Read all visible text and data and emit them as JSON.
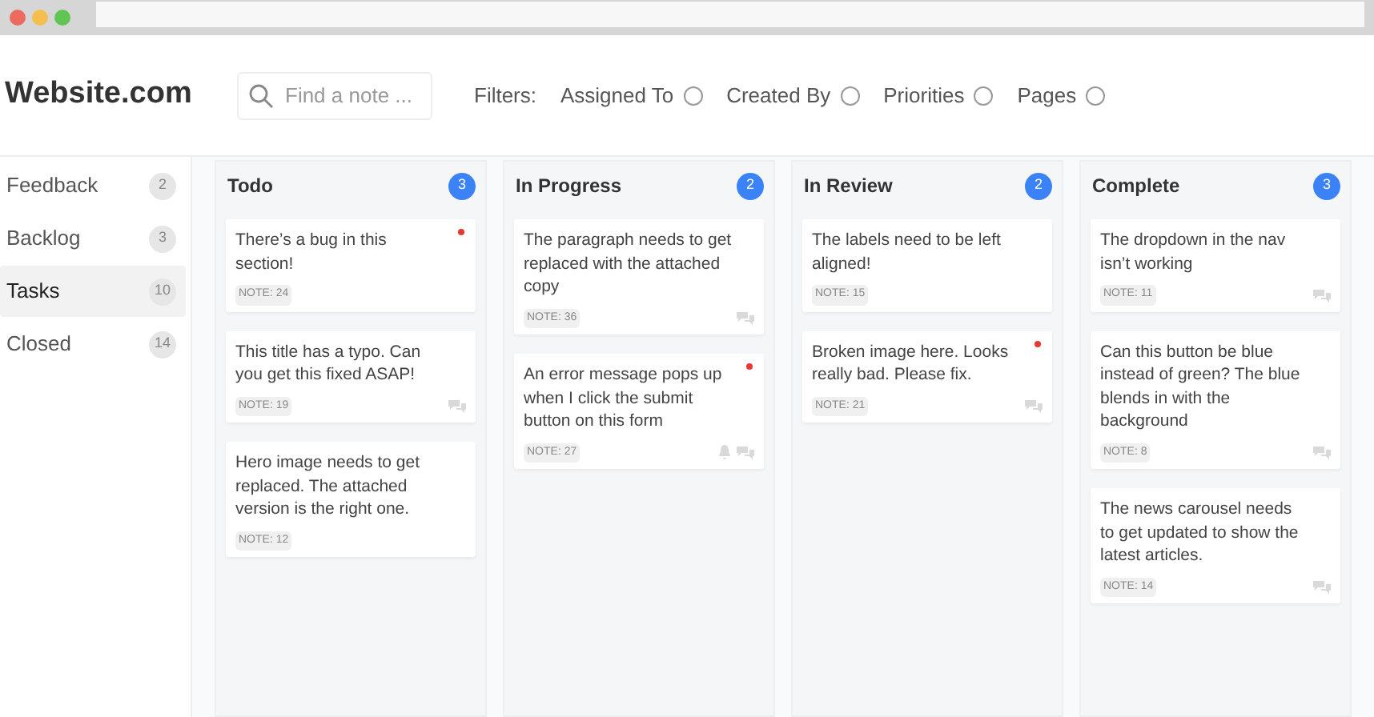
{
  "site": {
    "title": "Website.com"
  },
  "search": {
    "placeholder": "Find a note ..."
  },
  "filters": {
    "label": "Filters:",
    "items": [
      {
        "label": "Assigned To",
        "checked": false
      },
      {
        "label": "Created By",
        "checked": false
      },
      {
        "label": "Priorities",
        "checked": false
      },
      {
        "label": "Pages",
        "checked": false
      }
    ]
  },
  "sidebar": {
    "items": [
      {
        "label": "Feedback",
        "count": "2",
        "selected": false
      },
      {
        "label": "Backlog",
        "count": "3",
        "selected": false
      },
      {
        "label": "Tasks",
        "count": "10",
        "selected": true
      },
      {
        "label": "Closed",
        "count": "14",
        "selected": false
      }
    ]
  },
  "columns": [
    {
      "title": "Todo",
      "count": "3",
      "cards": [
        {
          "text": "There’s a bug in this section!",
          "note": "NOTE: 24",
          "flagged": true,
          "comments": false,
          "alert": false
        },
        {
          "text": "This title has a typo. Can you get this fixed ASAP!",
          "note": "NOTE: 19",
          "flagged": false,
          "comments": true,
          "alert": false
        },
        {
          "text": "Hero image needs to get replaced. The attached version is the right one.",
          "note": "NOTE: 12",
          "flagged": false,
          "comments": false,
          "alert": false
        }
      ]
    },
    {
      "title": "In Progress",
      "count": "2",
      "cards": [
        {
          "text": "The paragraph needs to get replaced with the attached copy",
          "note": "NOTE: 36",
          "flagged": false,
          "comments": true,
          "alert": false
        },
        {
          "text": "An error message pops up when I click the submit button on this form",
          "note": "NOTE: 27",
          "flagged": true,
          "comments": true,
          "alert": true
        }
      ]
    },
    {
      "title": "In Review",
      "count": "2",
      "cards": [
        {
          "text": "The labels need to be left aligned!",
          "note": "NOTE: 15",
          "flagged": false,
          "comments": false,
          "alert": false
        },
        {
          "text": "Broken image here. Looks really bad. Please fix.",
          "note": "NOTE: 21",
          "flagged": true,
          "comments": true,
          "alert": false
        }
      ]
    },
    {
      "title": "Complete",
      "count": "3",
      "cards": [
        {
          "text": "The dropdown in the nav isn’t working",
          "note": "NOTE: 11",
          "flagged": false,
          "comments": true,
          "alert": false
        },
        {
          "text": "Can this button be blue instead of green? The blue blends in with the background",
          "note": "NOTE: 8",
          "flagged": false,
          "comments": true,
          "alert": false
        },
        {
          "text": "The news carousel needs to get updated to show the latest articles.",
          "note": "NOTE: 14",
          "flagged": false,
          "comments": true,
          "alert": false
        }
      ]
    }
  ]
}
